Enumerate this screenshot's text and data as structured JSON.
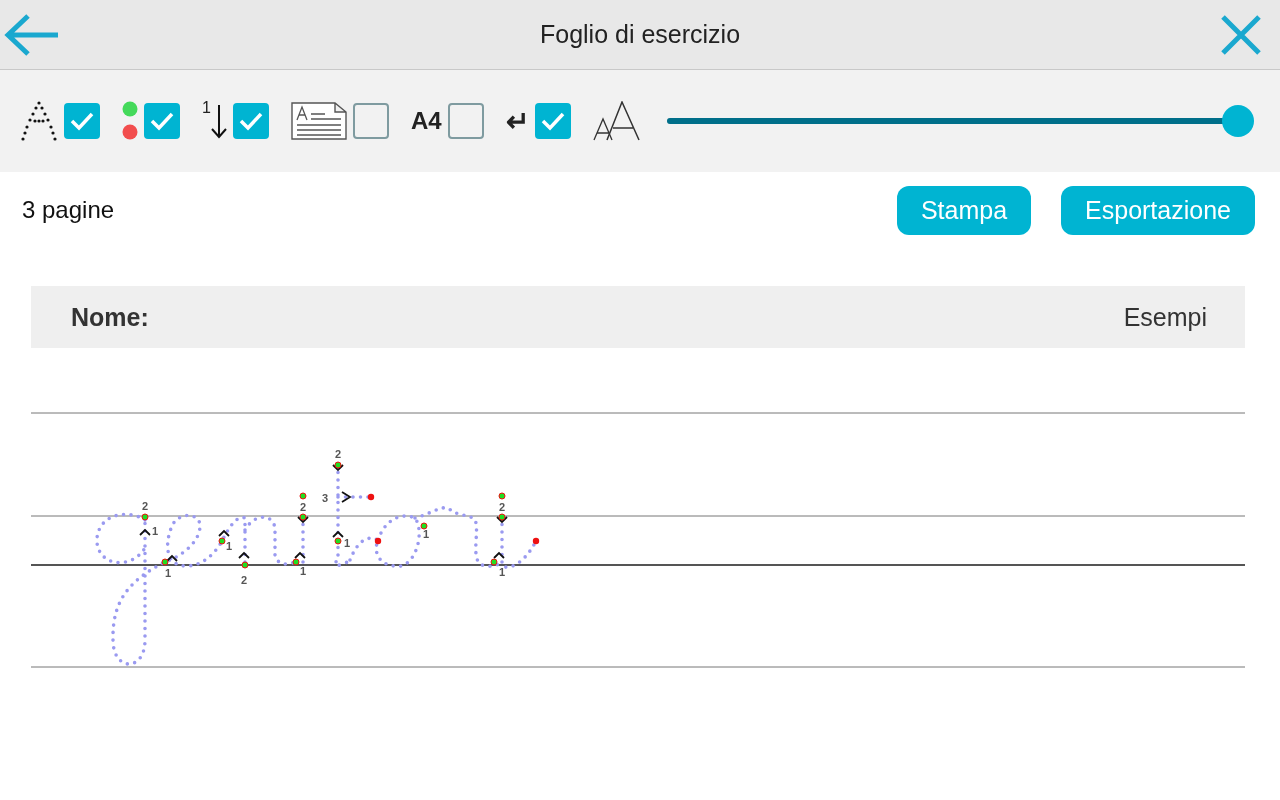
{
  "header": {
    "title": "Foglio di esercizio"
  },
  "options": [
    {
      "kind": "dotted-letter",
      "checked": true
    },
    {
      "kind": "color-dots",
      "checked": true
    },
    {
      "kind": "numbered-arrow",
      "text": "1",
      "checked": true
    },
    {
      "kind": "document",
      "checked": false
    },
    {
      "kind": "text",
      "text": "A4",
      "checked": false
    },
    {
      "kind": "glyph",
      "text": "↵",
      "checked": true
    }
  ],
  "font_size": {
    "level": 1.0
  },
  "page_count": "3 pagine",
  "buttons": [
    "Stampa",
    "Esportazione"
  ],
  "sheet": {
    "name_label": "Nome:",
    "examples_label": "Esempi",
    "stroke_numbers": [
      "2",
      "1",
      "1",
      "1",
      "2",
      "2",
      "1",
      "2",
      "3",
      "1",
      "1",
      "2",
      "1"
    ]
  }
}
